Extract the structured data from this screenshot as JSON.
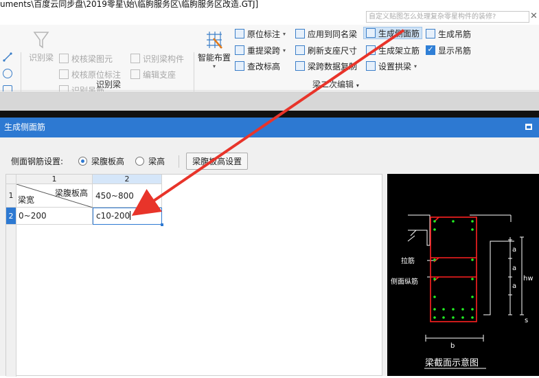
{
  "window": {
    "title": "uments\\百度云同步盘\\2019零星\\始\\临朐服务区\\临朐服务区改造.GTJ]"
  },
  "search": {
    "placeholder": "自定义贴图怎么处理复杂零星构件的装修?",
    "close": "✕"
  },
  "ribbon": {
    "group_identify": {
      "label": "识别梁",
      "big_button": "识别梁",
      "items": [
        "校核梁图元",
        "识别梁构件",
        "校核原位标注",
        "编辑支座",
        "识别吊筋"
      ]
    },
    "group_edit": {
      "label": "梁二次编辑",
      "big_button": "智能布置",
      "col1": [
        "原位标注",
        "重提梁跨",
        "查改标高"
      ],
      "col2": [
        "应用到同名梁",
        "刷新支座尺寸",
        "梁跨数据复制"
      ],
      "col3": [
        "生成侧面筋",
        "生成架立筋",
        "设置拱梁"
      ],
      "col4": [
        "生成吊筋",
        "显示吊筋"
      ]
    }
  },
  "panel": {
    "title": "生成侧面筋",
    "setting_label": "侧面钢筋设置:",
    "radio_options": [
      "梁腹板高",
      "梁高"
    ],
    "selected_radio": "梁腹板高",
    "button": "梁腹板高设置"
  },
  "table": {
    "col_headers": [
      "1",
      "2"
    ],
    "row_headers": [
      "1",
      "2"
    ],
    "corner_top": "梁腹板高",
    "corner_bottom": "梁宽",
    "rows": [
      [
        "",
        "450~800"
      ],
      [
        "0~200",
        "c10-200"
      ]
    ]
  },
  "diagram": {
    "caption": "梁截面示意图",
    "labels": {
      "tie": "拉筋",
      "side_long": "侧面纵筋",
      "a": "a",
      "hw": "hw",
      "s": "s",
      "b": "b"
    }
  },
  "colors": {
    "accent": "#2d79d2",
    "arrow": "#e8342a",
    "rebar": "#ff2020",
    "dot": "#22ee22"
  }
}
